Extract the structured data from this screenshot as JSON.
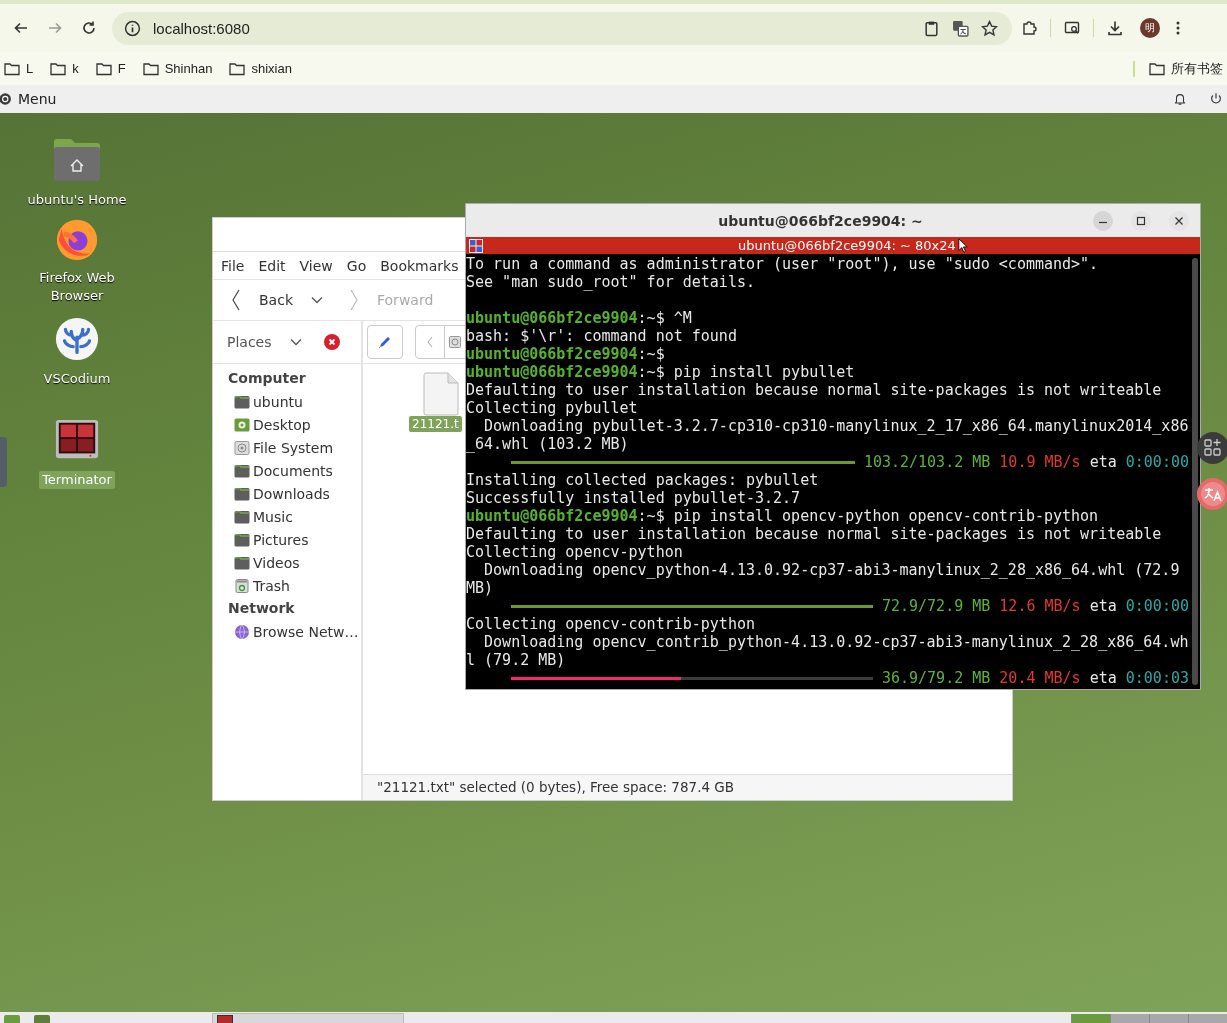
{
  "browser": {
    "url": "localhost:6080",
    "profile_initial": "明",
    "bookmarks": [
      {
        "label": "L"
      },
      {
        "label": "k"
      },
      {
        "label": "F"
      },
      {
        "label": "Shinhan"
      },
      {
        "label": "shixian"
      }
    ],
    "all_bookmarks": "所有书签"
  },
  "panel": {
    "menu_label": "Menu"
  },
  "desktop_icons": [
    {
      "label": "ubuntu's Home",
      "kind": "home",
      "selected": false
    },
    {
      "label": "Firefox Web Browser",
      "kind": "firefox",
      "selected": false
    },
    {
      "label": "VSCodium",
      "kind": "vscodium",
      "selected": false
    },
    {
      "label": "Terminator",
      "kind": "terminator",
      "selected": true
    }
  ],
  "file_manager": {
    "menu": [
      "File",
      "Edit",
      "View",
      "Go",
      "Bookmarks"
    ],
    "back_label": "Back",
    "forward_label": "Forward",
    "forward_disabled": true,
    "places_label": "Places",
    "sidebar": [
      {
        "heading": "Computer",
        "items": [
          {
            "label": "ubuntu",
            "kind": "folder"
          },
          {
            "label": "Desktop",
            "kind": "desktop"
          },
          {
            "label": "File System",
            "kind": "drive"
          },
          {
            "label": "Documents",
            "kind": "folder"
          },
          {
            "label": "Downloads",
            "kind": "folder"
          },
          {
            "label": "Music",
            "kind": "folder"
          },
          {
            "label": "Pictures",
            "kind": "folder"
          },
          {
            "label": "Videos",
            "kind": "folder"
          },
          {
            "label": "Trash",
            "kind": "trash"
          }
        ]
      },
      {
        "heading": "Network",
        "items": [
          {
            "label": "Browse Netw…",
            "kind": "network"
          }
        ]
      }
    ],
    "files": [
      {
        "name": "21121.t",
        "selected": true
      }
    ],
    "status": "\"21121.txt\" selected (0 bytes), Free space: 787.4 GB"
  },
  "terminal": {
    "title": "ubuntu@066bf2ce9904: ~",
    "tab_title": "ubuntu@066bf2ce9904: ~ 80x24",
    "lines": [
      {
        "kind": "text",
        "text": "To run a command as administrator (user \"root\"), use \"sudo <command>\"."
      },
      {
        "kind": "text",
        "text": "See \"man sudo_root\" for details."
      },
      {
        "kind": "blank"
      },
      {
        "kind": "prompt",
        "user": "ubuntu@066bf2ce9904",
        "path": ":~$",
        "command": "^M"
      },
      {
        "kind": "text",
        "text": "bash: $'\\r': command not found"
      },
      {
        "kind": "prompt",
        "user": "ubuntu@066bf2ce9904",
        "path": ":~$"
      },
      {
        "kind": "prompt",
        "user": "ubuntu@066bf2ce9904",
        "path": ":~$",
        "command": "pip install pybullet"
      },
      {
        "kind": "text",
        "text": "Defaulting to user installation because normal site-packages is not writeable"
      },
      {
        "kind": "text",
        "text": "Collecting pybullet"
      },
      {
        "kind": "text",
        "text": "  Downloading pybullet-3.2.7-cp310-cp310-manylinux_2_17_x86_64.manylinux2014_x86"
      },
      {
        "kind": "text",
        "text": "_64.whl (103.2 MB)"
      },
      {
        "kind": "progress",
        "level": 1,
        "size": "103.2/103.2 MB",
        "speed": "10.9 MB/s",
        "eta_label": "eta",
        "eta": "0:00:00"
      },
      {
        "kind": "text",
        "text": "Installing collected packages: pybullet"
      },
      {
        "kind": "text",
        "text": "Successfully installed pybullet-3.2.7"
      },
      {
        "kind": "prompt",
        "user": "ubuntu@066bf2ce9904",
        "path": ":~$",
        "command": "pip install opencv-python opencv-contrib-python"
      },
      {
        "kind": "text",
        "text": "Defaulting to user installation because normal site-packages is not writeable"
      },
      {
        "kind": "text",
        "text": "Collecting opencv-python"
      },
      {
        "kind": "text",
        "text": "  Downloading opencv_python-4.13.0.92-cp37-abi3-manylinux_2_28_x86_64.whl (72.9"
      },
      {
        "kind": "text",
        "text": "MB)"
      },
      {
        "kind": "progress",
        "level": 1,
        "size": "72.9/72.9 MB",
        "speed": "12.6 MB/s",
        "eta_label": "eta",
        "eta": "0:00:00"
      },
      {
        "kind": "text",
        "text": "Collecting opencv-contrib-python"
      },
      {
        "kind": "text",
        "text": "  Downloading opencv_contrib_python-4.13.0.92-cp37-abi3-manylinux_2_28_x86_64.wh"
      },
      {
        "kind": "text",
        "text": "l (79.2 MB)"
      },
      {
        "kind": "progress",
        "level": 0.47,
        "size": "36.9/79.2 MB",
        "speed": "20.4 MB/s",
        "eta_label": "eta",
        "eta": "0:00:03"
      }
    ]
  }
}
